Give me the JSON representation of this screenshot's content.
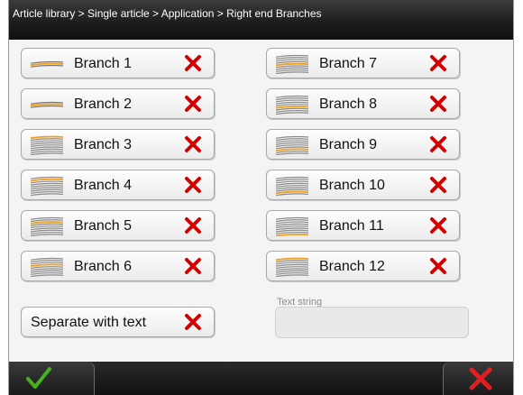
{
  "breadcrumb": "Article library > Single article > Application > Right end Branches",
  "branches": [
    {
      "label": "Branch 1"
    },
    {
      "label": "Branch 2"
    },
    {
      "label": "Branch 3"
    },
    {
      "label": "Branch 4"
    },
    {
      "label": "Branch 5"
    },
    {
      "label": "Branch 6"
    },
    {
      "label": "Branch 7"
    },
    {
      "label": "Branch 8"
    },
    {
      "label": "Branch 9"
    },
    {
      "label": "Branch 10"
    },
    {
      "label": "Branch 11"
    },
    {
      "label": "Branch 12"
    }
  ],
  "separate_label": "Separate with text",
  "text_string": {
    "label": "Text string",
    "value": ""
  },
  "icons": {
    "branch": "branch-pattern-icon",
    "remove": "red-x-icon",
    "ok": "green-check-icon",
    "cancel": "red-x-icon"
  },
  "colors": {
    "accent_orange": "#f0a020",
    "remove_red": "#d40000",
    "ok_green": "#45b020",
    "cancel_red": "#e02020"
  }
}
